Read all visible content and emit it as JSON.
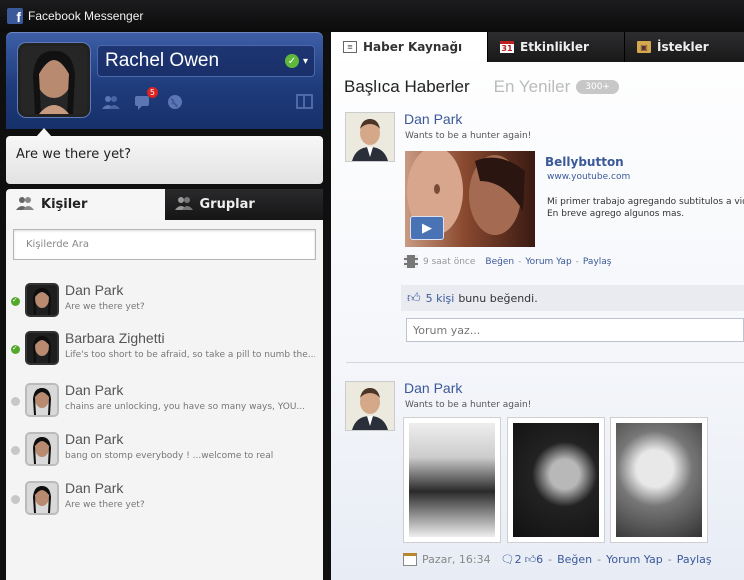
{
  "app": {
    "title": "Facebook Messenger",
    "logo_letter": "f"
  },
  "profile": {
    "name": "Rachel Owen",
    "notification_count": "5",
    "status_message": "Are we there yet?"
  },
  "left_tabs": [
    {
      "label": "Kişiler"
    },
    {
      "label": "Gruplar"
    }
  ],
  "search": {
    "placeholder": "Kişilerde Ara"
  },
  "contacts": [
    {
      "name": "Dan Park",
      "message": "Are we there yet?",
      "online": true
    },
    {
      "name": "Barbara Zighetti",
      "message": "Life's too short to be afraid, so take a pill to numb the...",
      "online": true
    },
    {
      "name": "Dan Park",
      "message": "chains are unlocking, you have so many ways, YOU...",
      "online": false
    },
    {
      "name": "Dan Park",
      "message": "bang on stomp everybody ! ...welcome to real",
      "online": false
    },
    {
      "name": "Dan Park",
      "message": "Are we there yet?",
      "online": false
    }
  ],
  "right_tabs": [
    {
      "label": "Haber Kaynağı",
      "icon": "31-calendar-day"
    },
    {
      "label": "Etkinlikler",
      "icon": "31"
    },
    {
      "label": "İstekler"
    }
  ],
  "feed": {
    "title": "Başlıca Haberler",
    "recent": "En Yeniler",
    "count": "300+",
    "posts": [
      {
        "author": "Dan Park",
        "text": "Wants to be a hunter again!",
        "link": {
          "title": "Bellybutton",
          "url": "www.youtube.com",
          "desc1": "Mi primer trabajo agregando subtitulos a video",
          "desc2": "En breve agrego algunos mas."
        },
        "time": "9 saat önce",
        "actions": [
          "Beğen",
          "Yorum Yap",
          "Paylaş"
        ],
        "likes_count": "5 kişi",
        "likes_text": "bunu beğendi.",
        "comment_placeholder": "Yorum yaz..."
      },
      {
        "author": "Dan Park",
        "text": "Wants to be a hunter again!",
        "time": "Pazar, 16:34",
        "comments": "2",
        "likes": "6",
        "actions": [
          "Beğen",
          "Yorum Yap",
          "Paylaş"
        ]
      }
    ]
  }
}
